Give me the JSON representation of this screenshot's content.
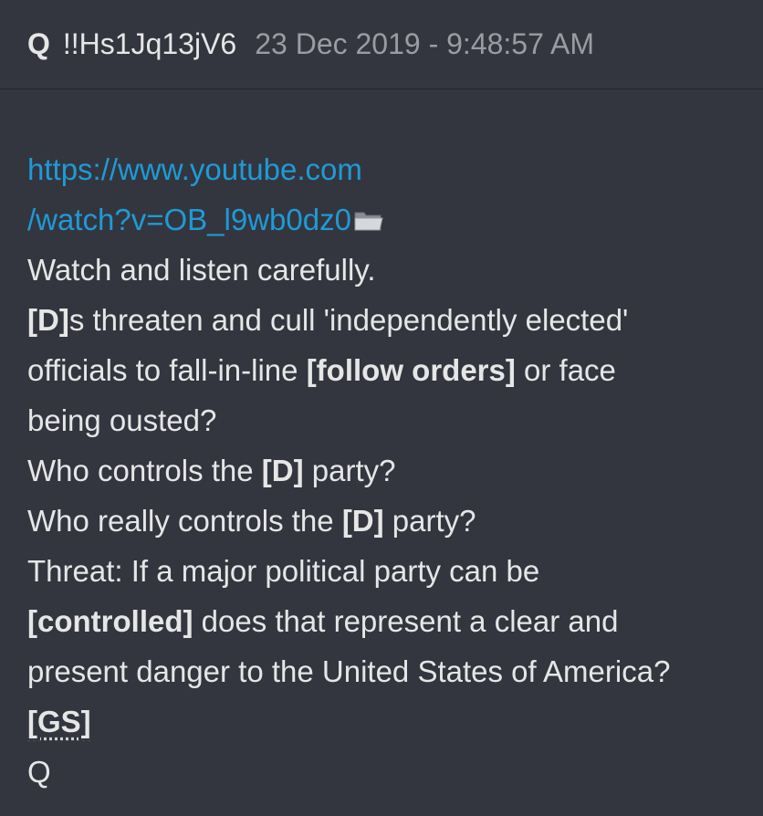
{
  "post": {
    "author": "Q",
    "tripcode": "!!Hs1Jq13jV6",
    "timestamp": "23 Dec 2019 - 9:48:57 AM",
    "link": {
      "line1": "https://www.youtube.com",
      "line2": "/watch?v=OB_l9wb0dz0"
    },
    "icons": {
      "archive": "folder-icon"
    },
    "lines": {
      "l1": "Watch and listen carefully.",
      "l2_tag": "[D]",
      "l2_rest": "s threaten and cull 'independently elected'",
      "l3_a": "officials to fall-in-line ",
      "l3_tag": "[follow orders]",
      "l3_b": " or face",
      "l4": "being ousted?",
      "l5_a": "Who controls the ",
      "l5_tag": "[D]",
      "l5_b": " party?",
      "l6_a": "Who really controls the ",
      "l6_tag": "[D]",
      "l6_b": " party?",
      "l7": "Threat: If a major political party can be",
      "l8_tag": "[controlled]",
      "l8_rest": " does that represent a clear and",
      "l9": "present danger to the United States of America?",
      "l10": "[GS]",
      "l11": "Q"
    }
  }
}
